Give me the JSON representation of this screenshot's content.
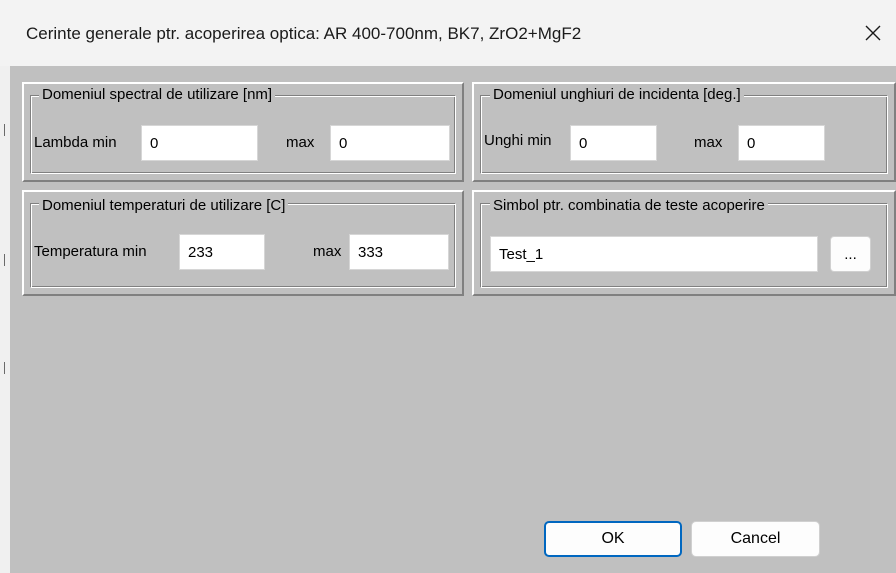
{
  "window": {
    "title": "Cerinte generale ptr. acoperirea optica: AR 400-700nm, BK7, ZrO2+MgF2",
    "close_icon": "close-icon"
  },
  "spectral": {
    "legend": "Domeniul spectral de utilizare [nm]",
    "min_label": "Lambda min",
    "min_value": "0",
    "max_label": "max",
    "max_value": "0"
  },
  "angles": {
    "legend": "Domeniul unghiuri de incidenta [deg.]",
    "min_label": "Unghi min",
    "min_value": "0",
    "max_label": "max",
    "max_value": "0"
  },
  "temperature": {
    "legend": "Domeniul temperaturi de utilizare [C]",
    "min_label": "Temperatura min",
    "min_value": "233",
    "max_label": "max",
    "max_value": "333"
  },
  "symbol": {
    "legend": "Simbol ptr. combinatia de teste acoperire",
    "value": "Test_1",
    "browse_label": "..."
  },
  "buttons": {
    "ok": "OK",
    "cancel": "Cancel"
  },
  "colors": {
    "client_background": "#c0c0c0",
    "default_button_border": "#0067c0"
  }
}
